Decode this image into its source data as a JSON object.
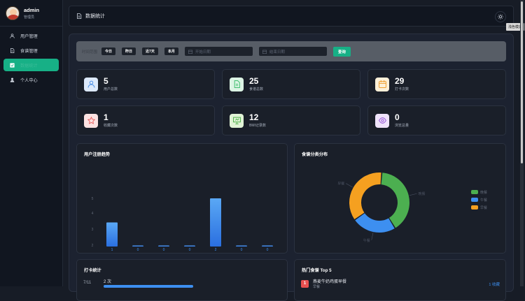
{
  "sidebar": {
    "user_name": "admin",
    "user_role": "管理员",
    "items": [
      {
        "label": "用户管理",
        "icon": "user-icon"
      },
      {
        "label": "食谱管理",
        "icon": "document-icon"
      },
      {
        "label": "数据统计",
        "icon": "chart-icon",
        "active": true
      },
      {
        "label": "个人中心",
        "icon": "person-icon"
      }
    ]
  },
  "header": {
    "title": "数据统计",
    "theme_tooltip": "浅色模式"
  },
  "filter": {
    "label": "时间范围",
    "quick": [
      "今日",
      "昨日",
      "近7天",
      "本月"
    ],
    "start_placeholder": "开始日期",
    "end_placeholder": "结束日期",
    "query": "查询"
  },
  "stats": [
    {
      "value": "5",
      "label": "用户总数",
      "icon": "user-icon",
      "color": "#4a8fe7",
      "bg": "#dce9fb"
    },
    {
      "value": "25",
      "label": "食谱总数",
      "icon": "document-icon",
      "color": "#3fbf6f",
      "bg": "#dcf4e4"
    },
    {
      "value": "29",
      "label": "打卡次数",
      "icon": "calendar-icon",
      "color": "#f0a030",
      "bg": "#fdf0d8"
    },
    {
      "value": "1",
      "label": "收藏次数",
      "icon": "star-icon",
      "color": "#e85858",
      "bg": "#fce2e2"
    },
    {
      "value": "12",
      "label": "BMI记录数",
      "icon": "monitor-icon",
      "color": "#4fb04a",
      "bg": "#e1f3d6"
    },
    {
      "value": "0",
      "label": "浏览总量",
      "icon": "eye-icon",
      "color": "#9a5bd8",
      "bg": "#efe3fb"
    }
  ],
  "reg_chart": {
    "title": "用户注册趋势"
  },
  "cat_chart": {
    "title": "食谱分类分布"
  },
  "checkin": {
    "title": "打卡统计",
    "row_date": "7/11",
    "row_value": "2 次"
  },
  "top5": {
    "title": "热门食谱 Top 5",
    "items": [
      {
        "rank": "1",
        "name": "燕麦牛奶鸡蛋早餐",
        "sub": "早餐",
        "count": "1 收藏"
      }
    ]
  },
  "chart_data": [
    {
      "type": "bar",
      "title": "用户注册趋势",
      "categories": [
        "7/11",
        "7/12",
        "7/13",
        "7/14",
        "7/15",
        "7/16",
        "7/17"
      ],
      "values": [
        1,
        0,
        0,
        0,
        2,
        0,
        0
      ],
      "ylim": [
        0,
        2.5
      ],
      "yticks": [
        "1",
        "2",
        "3",
        "4",
        "5"
      ]
    },
    {
      "type": "pie",
      "title": "食谱分类分布",
      "categories": [
        "晚餐",
        "午餐",
        "早餐"
      ],
      "values": [
        10,
        6,
        9
      ],
      "colors": [
        "#4caf50",
        "#3d8ff0",
        "#f5a020"
      ]
    }
  ]
}
